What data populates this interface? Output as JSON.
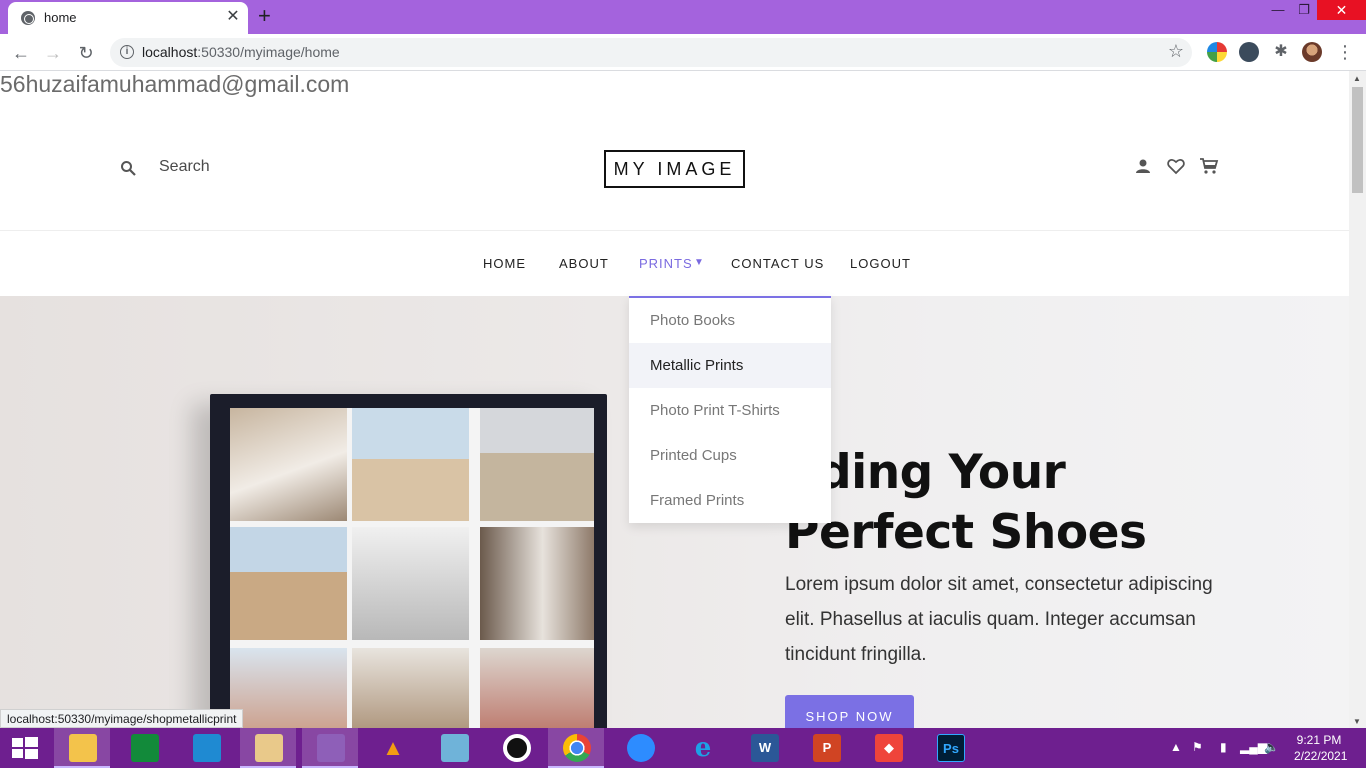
{
  "browser": {
    "tab_title": "home",
    "url_host": "localhost",
    "url_path": ":50330/myimage/home"
  },
  "page": {
    "user_email": "56huzaifamuhammad@gmail.com",
    "search_label": "Search",
    "logo": "MY IMAGE",
    "nav": {
      "home": "HOME",
      "about": "ABOUT",
      "prints": "PRINTS",
      "contact": "CONTACT US",
      "logout": "LOGOUT"
    },
    "dropdown": [
      {
        "label": "Photo Books"
      },
      {
        "label": "Metallic Prints"
      },
      {
        "label": "Photo Print T-Shirts"
      },
      {
        "label": "Printed Cups"
      },
      {
        "label": "Framed Prints"
      }
    ],
    "hero": {
      "title_line1": "nding Your",
      "title_line2": "Perfect Shoes",
      "text": "Lorem ipsum dolor sit amet, consectetur adipiscing elit. Phasellus at iaculis quam. Integer accumsan tincidunt fringilla.",
      "button": "SHOP NOW"
    },
    "status_url": "localhost:50330/myimage/shopmetallicprint"
  },
  "taskbar": {
    "time": "9:21 PM",
    "date": "2/22/2021"
  },
  "colors": {
    "tabbar": "#a463dd",
    "accent": "#7b70e4",
    "taskbar": "#6e1f8f"
  }
}
